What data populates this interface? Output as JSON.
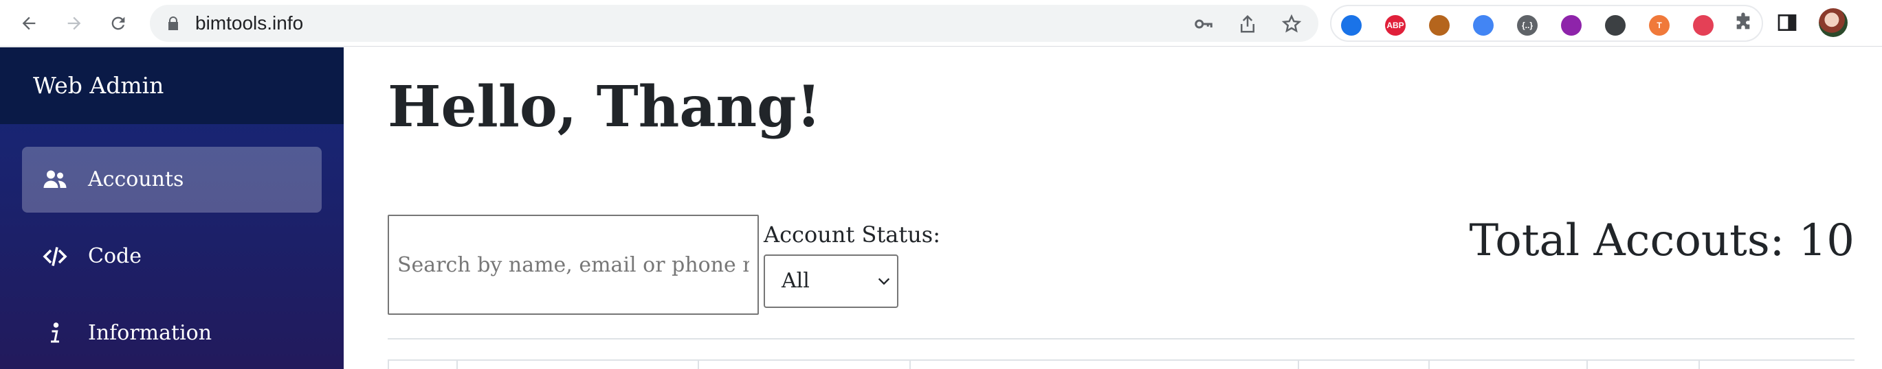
{
  "browser": {
    "url": "bimtools.info",
    "extensions": [
      {
        "name": "heart-extension-icon",
        "color": "#1a73e8",
        "text": ""
      },
      {
        "name": "adblock-plus-icon",
        "color": "#e0203a",
        "text": "ABP"
      },
      {
        "name": "cookie-extension-icon",
        "color": "#b5651d",
        "text": ""
      },
      {
        "name": "google-translate-icon",
        "color": "#4285f4",
        "text": ""
      },
      {
        "name": "json-formatter-icon",
        "color": "#5f6368",
        "text": "{..}"
      },
      {
        "name": "screen-capture-icon",
        "color": "#8e24aa",
        "text": ""
      },
      {
        "name": "eyedropper-icon",
        "color": "#3c4043",
        "text": ""
      },
      {
        "name": "todoist-icon",
        "color": "#f0793a",
        "text": "T"
      },
      {
        "name": "toggle-extension-icon",
        "color": "#e44056",
        "text": ""
      }
    ]
  },
  "sidebar": {
    "brand": "Web Admin",
    "items": [
      {
        "label": "Accounts",
        "icon": "users-icon",
        "active": true
      },
      {
        "label": "Code",
        "icon": "code-icon",
        "active": false
      },
      {
        "label": "Information",
        "icon": "info-icon",
        "active": false
      }
    ]
  },
  "main": {
    "greeting": "Hello, Thang!",
    "search_placeholder": "Search by name, email or phone number",
    "status_label": "Account Status:",
    "status_value": "All",
    "total_text": "Total Accouts: 10"
  },
  "colors": {
    "sidebar_top": "#16287a",
    "sidebar_bottom": "#221a5c",
    "brand_bg": "#0a1a47",
    "text": "#212529"
  }
}
